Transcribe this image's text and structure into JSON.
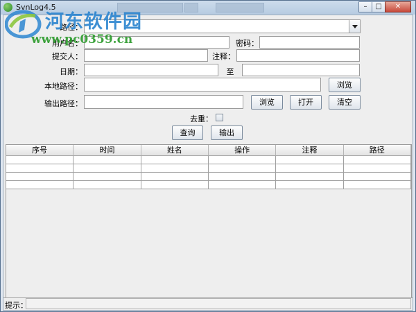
{
  "window": {
    "title": "SvnLog4.5"
  },
  "watermark": {
    "name": "河东软件园",
    "url": "www.pc0359.cn"
  },
  "form": {
    "path_label": "路径：",
    "username_label": "用户名：",
    "password_label": "密码：",
    "committer_label": "提交人：",
    "comment_label": "注释：",
    "date_label": "日期：",
    "date_to_label": "至",
    "local_path_label": "本地路径：",
    "output_path_label": "输出路径：",
    "dedupe_label": "去重：",
    "path_value": "",
    "username_value": "",
    "password_value": "",
    "committer_value": "",
    "comment_value": "",
    "date_from_value": "",
    "date_to_value": "",
    "local_path_value": "",
    "output_path_value": ""
  },
  "buttons": {
    "browse_local": "浏览",
    "browse_output": "浏览",
    "open": "打开",
    "clear": "清空",
    "query": "查询",
    "export": "输出"
  },
  "table": {
    "columns": [
      "序号",
      "时间",
      "姓名",
      "操作",
      "注释",
      "路径"
    ],
    "row_count": 4
  },
  "status": {
    "label": "提示：",
    "value": ""
  }
}
